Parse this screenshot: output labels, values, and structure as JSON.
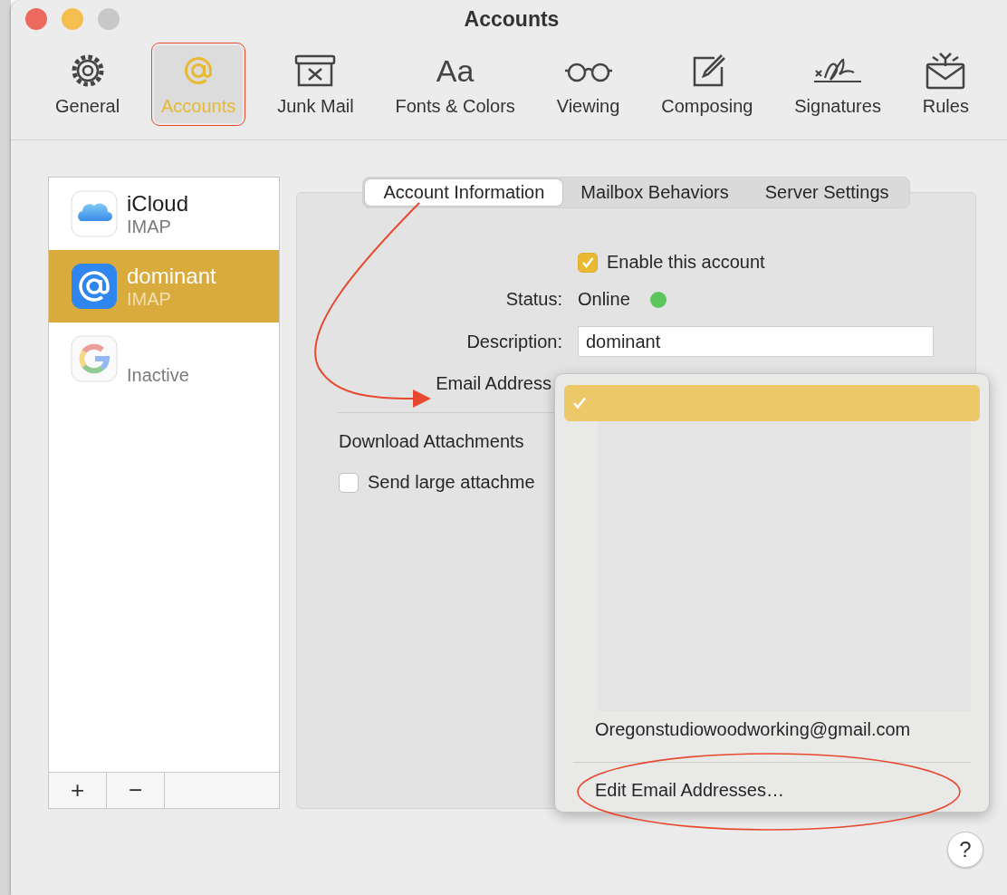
{
  "window": {
    "title": "Accounts",
    "buttons": [
      {
        "kind": "close",
        "disabled": false
      },
      {
        "kind": "minimize",
        "disabled": false
      },
      {
        "kind": "zoom",
        "disabled": true
      }
    ]
  },
  "toolbar": [
    {
      "label": "General",
      "kind": "gear",
      "selected": false
    },
    {
      "label": "Accounts",
      "kind": "at",
      "selected": true
    },
    {
      "label": "Junk Mail",
      "kind": "junk",
      "selected": false
    },
    {
      "label": "Fonts & Colors",
      "kind": "glyph",
      "glyph": "Aa",
      "selected": false
    },
    {
      "label": "Viewing",
      "kind": "glasses",
      "selected": false
    },
    {
      "label": "Composing",
      "kind": "compose",
      "selected": false
    },
    {
      "label": "Signatures",
      "kind": "signature",
      "selected": false
    },
    {
      "label": "Rules",
      "kind": "rules",
      "selected": false
    }
  ],
  "accounts": [
    {
      "kind": "icloud",
      "name": "iCloud",
      "type": "IMAP",
      "selected": false
    },
    {
      "kind": "at",
      "name": "dominant",
      "type": "IMAP",
      "selected": true
    },
    {
      "kind": "google",
      "type": "Inactive",
      "selected": false
    }
  ],
  "list_buttons": [
    "+",
    "−"
  ],
  "tabs": [
    {
      "label": "Account Information",
      "selected": true
    },
    {
      "label": "Mailbox Behaviors",
      "selected": false
    },
    {
      "label": "Server Settings",
      "selected": false
    }
  ],
  "form": {
    "enable": {
      "label": "Enable this account",
      "checked": true
    },
    "status": {
      "label": "Status:",
      "value": "Online",
      "online": true
    },
    "description": {
      "label": "Description:",
      "value": "dominant"
    },
    "email": {
      "label": "Email Address"
    },
    "download": {
      "label": "Download Attachments"
    },
    "send_large": {
      "label": "Send large attachme",
      "checked": false
    }
  },
  "menu": {
    "redacted": true,
    "items": [
      {
        "selected": true
      },
      {
        "text": "Oregonstudiowoodworking@gmail.com",
        "selected": false
      }
    ],
    "footer": "Edit Email Addresses…"
  },
  "help": "?"
}
